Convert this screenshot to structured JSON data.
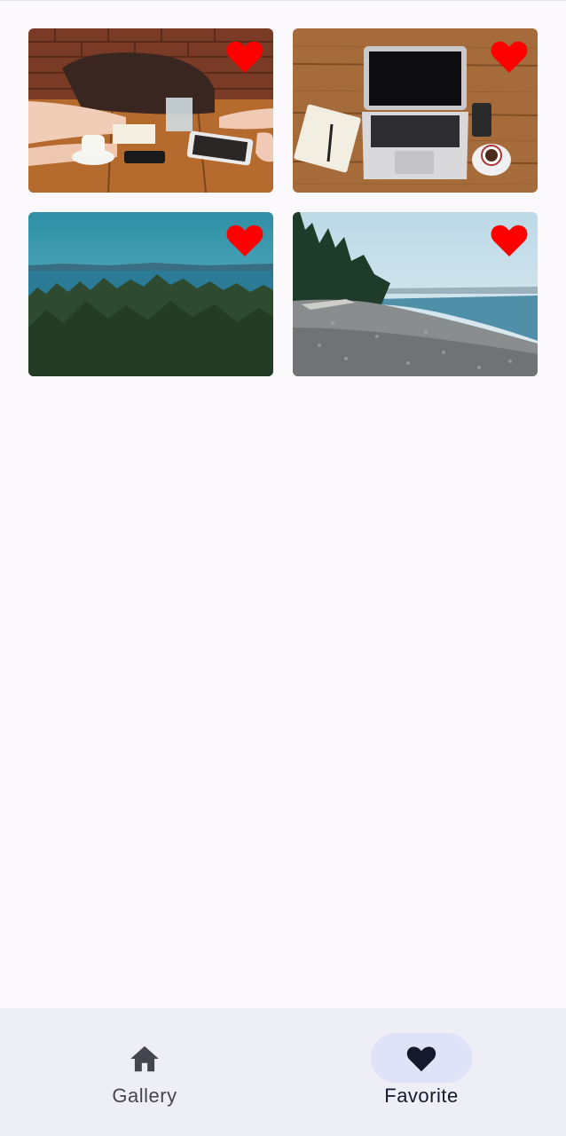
{
  "gallery": {
    "items": [
      {
        "alt": "Meeting at a wooden table",
        "favorite": true,
        "favorite_icon": "heart-filled-icon"
      },
      {
        "alt": "Laptop and notebook on desk",
        "favorite": true,
        "favorite_icon": "heart-filled-icon"
      },
      {
        "alt": "Forest and sea landscape",
        "favorite": true,
        "favorite_icon": "heart-filled-icon"
      },
      {
        "alt": "Pebble beach and forest",
        "favorite": true,
        "favorite_icon": "heart-filled-icon"
      }
    ]
  },
  "bottom_nav": {
    "items": [
      {
        "label": "Gallery",
        "icon": "home-icon",
        "active": false
      },
      {
        "label": "Favorite",
        "icon": "heart-icon",
        "active": true
      }
    ]
  },
  "colors": {
    "background": "#fcf9fc",
    "nav_background": "#eeeef6",
    "active_pill": "#dfe3f8",
    "favorite_heart": "#ff0000",
    "nav_icon": "#44464f",
    "nav_icon_active": "#141a2c"
  }
}
